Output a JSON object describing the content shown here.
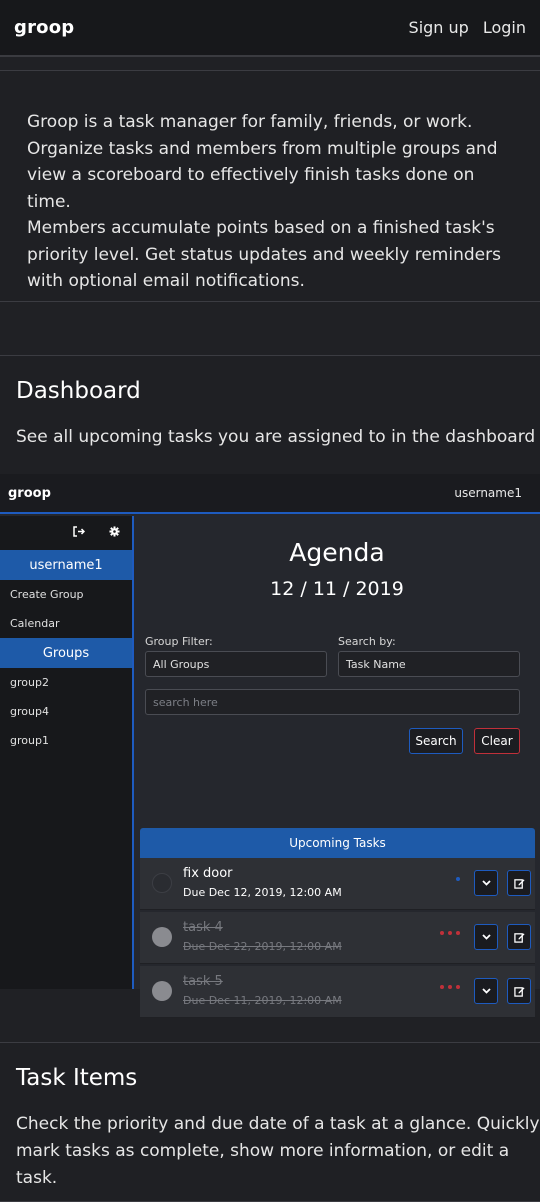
{
  "nav": {
    "brand": "groop",
    "signup": "Sign up",
    "login": "Login"
  },
  "intro": {
    "lines": [
      "Groop is a task manager for family, friends, or work.",
      "Organize tasks and members from multiple groups and",
      "view a scoreboard to effectively finish tasks done on time.",
      "Members accumulate points based on a finished task's",
      "priority level. Get status updates and weekly reminders",
      "with optional email notifications."
    ]
  },
  "dashboard": {
    "title": "Dashboard",
    "text": "See all upcoming tasks you are assigned to in the dashboard"
  },
  "app": {
    "brand": "groop",
    "username": "username1",
    "sidebar": {
      "icons": [
        "sign-out-icon",
        "gear-icon"
      ],
      "user": "username1",
      "create_group": "Create Group",
      "calendar": "Calendar",
      "groups_header": "Groups",
      "groups": [
        "group2",
        "group4",
        "group1"
      ]
    },
    "agenda_title": "Agenda",
    "agenda_date": "12 / 11 / 2019",
    "group_filter_label": "Group Filter:",
    "group_filter_value": "All Groups",
    "search_by_label": "Search by:",
    "search_by_value": "Task Name",
    "search_placeholder": "search here",
    "search_button": "Search",
    "clear_button": "Clear",
    "upcoming_header": "Upcoming Tasks",
    "tasks": [
      {
        "name": "fix door",
        "due": "Due Dec 12, 2019, 12:00 AM",
        "completed": false,
        "priority_dots": 1,
        "priority_color": "#1e5bbf"
      },
      {
        "name": "task 4",
        "due": "Due Dec 22, 2019, 12:00 AM",
        "completed": true,
        "priority_dots": 3,
        "priority_color": "#c0303a"
      },
      {
        "name": "task 5",
        "due": "Due Dec 11, 2019, 12:00 AM",
        "completed": true,
        "priority_dots": 3,
        "priority_color": "#c0303a"
      }
    ],
    "colors": {
      "accent": "#1e5aa8",
      "danger": "#c0303a"
    }
  },
  "task_items": {
    "title": "Task Items",
    "lines": [
      "Check the priority and due date of a task at a glance. Quickly",
      "mark tasks as complete, show more information, or edit a",
      "task."
    ]
  }
}
